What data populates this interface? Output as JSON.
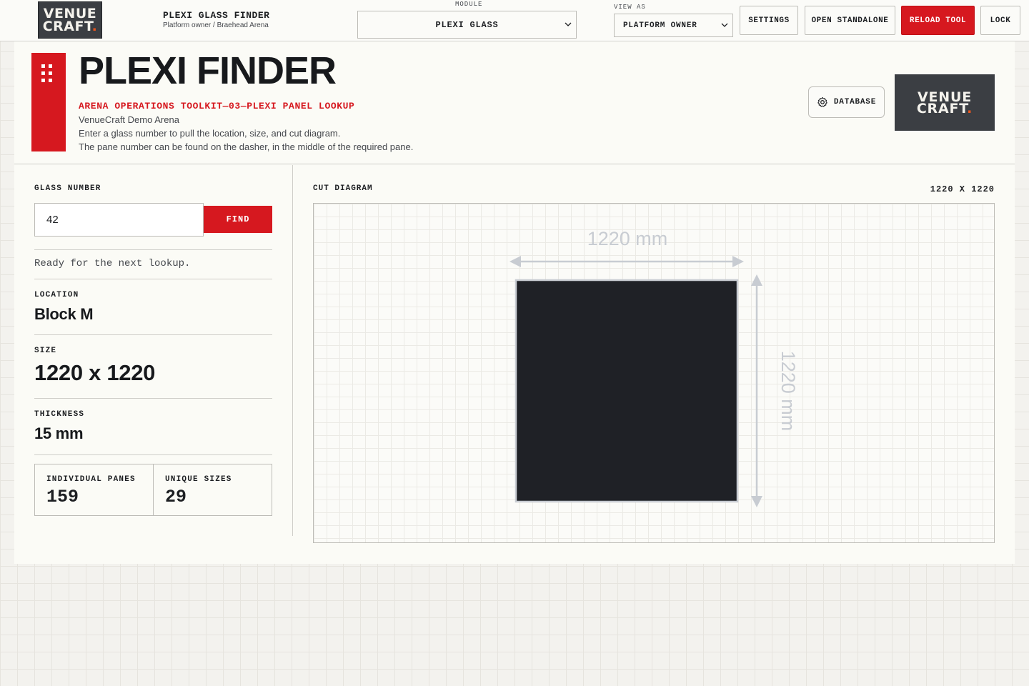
{
  "topbar": {
    "logo_line1": "VENUE",
    "logo_line2": "CRAFT",
    "logo_dot": ".",
    "app_title": "PLEXI GLASS FINDER",
    "app_subtitle": "Platform owner / Braehead Arena",
    "module_label": "MODULE",
    "module_value": "PLEXI GLASS",
    "view_as_label": "VIEW AS",
    "view_as_value": "PLATFORM OWNER",
    "settings_label": "SETTINGS",
    "standalone_label": "OPEN STANDALONE",
    "reload_label": "RELOAD TOOL",
    "lock_label": "LOCK"
  },
  "header": {
    "title": "PLEXI FINDER",
    "kicker": "ARENA OPERATIONS TOOLKIT—03—PLEXI PANEL LOOKUP",
    "org": "VenueCraft Demo Arena",
    "desc1": "Enter a glass number to pull the location, size, and cut diagram.",
    "desc2": "The pane number can be found on the dasher, in the middle of the required pane.",
    "database_label": "DATABASE",
    "logo_line1": "VENUE",
    "logo_line2": "CRAFT",
    "logo_dot": "."
  },
  "lookup": {
    "glass_number_label": "GLASS NUMBER",
    "glass_number_value": "42",
    "find_label": "FIND",
    "status": "Ready for the next lookup.",
    "location_label": "LOCATION",
    "location_value": "Block M",
    "size_label": "SIZE",
    "size_value": "1220 x 1220",
    "thickness_label": "THICKNESS",
    "thickness_value": "15 mm",
    "panes_label": "INDIVIDUAL PANES",
    "panes_value": "159",
    "sizes_label": "UNIQUE SIZES",
    "sizes_value": "29"
  },
  "diagram": {
    "label": "CUT DIAGRAM",
    "size_readout": "1220 X 1220",
    "width_label": "1220 mm",
    "height_label": "1220 mm"
  },
  "colors": {
    "accent": "#d6181f",
    "pane": "#1f2126",
    "dimension": "#c8ccd2",
    "logo_bg": "#3b3e43",
    "logo_dot": "#e8551e"
  }
}
